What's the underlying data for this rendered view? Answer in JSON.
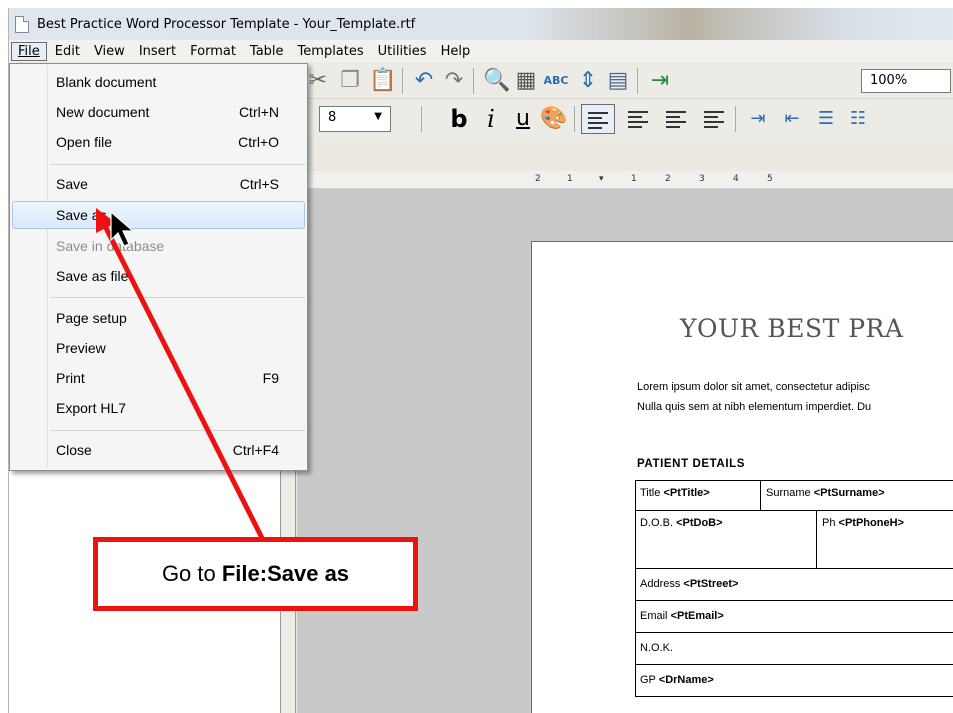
{
  "window": {
    "title": "Best Practice Word Processor Template - Your_Template.rtf"
  },
  "menubar": {
    "items": [
      {
        "label": "File",
        "key": "F"
      },
      {
        "label": "Edit",
        "key": "E"
      },
      {
        "label": "View",
        "key": "V"
      },
      {
        "label": "Insert",
        "key": "I"
      },
      {
        "label": "Format",
        "key": "m"
      },
      {
        "label": "Table",
        "key": "b"
      },
      {
        "label": "Templates",
        "key": "T"
      },
      {
        "label": "Utilities",
        "key": "U"
      },
      {
        "label": "Help",
        "key": "H"
      }
    ]
  },
  "file_menu": {
    "blank_document": "Blank document",
    "new_document": "New document",
    "new_document_shortcut": "Ctrl+N",
    "open_file": "Open file",
    "open_file_shortcut": "Ctrl+O",
    "save": "Save",
    "save_shortcut": "Ctrl+S",
    "save_as": "Save as",
    "save_in_database": "Save in database",
    "save_as_file": "Save as file",
    "page_setup": "Page setup",
    "preview": "Preview",
    "print": "Print",
    "print_shortcut": "F9",
    "export_hl7": "Export HL7",
    "close": "Close",
    "close_shortcut": "Ctrl+F4"
  },
  "toolbar": {
    "zoom": "100%",
    "font_size": "8",
    "bold": "b",
    "italic": "i",
    "underline": "u",
    "spell_check": "ABC"
  },
  "ruler": {
    "marks": [
      "2",
      "1",
      "1",
      "2",
      "3",
      "4",
      "5"
    ]
  },
  "document": {
    "title": "YOUR BEST PRA",
    "para_line1": "Lorem ipsum dolor sit amet, consectetur adipisc",
    "para_line2": "Nulla quis sem at nibh elementum imperdiet. Du",
    "section_heading": "PATIENT DETAILS",
    "title_label": "Title",
    "title_tag": "<PtTitle>",
    "surname_label": "Surname",
    "surname_tag": "<PtSurname>",
    "dob_label": "D.O.B.",
    "dob_tag": "<PtDoB>",
    "phone_label": "Ph",
    "phone_tag": "<PtPhoneH>",
    "address_label": "Address",
    "address_tag": "<PtStreet>",
    "email_label": "Email",
    "email_tag": "<PtEmail>",
    "nok_label": "N.O.K.",
    "gp_label": "GP",
    "gp_tag": "<DrName>"
  },
  "annotation": {
    "prefix": "Go to ",
    "emphasis": "File:Save as",
    "color": "#ee1111"
  }
}
